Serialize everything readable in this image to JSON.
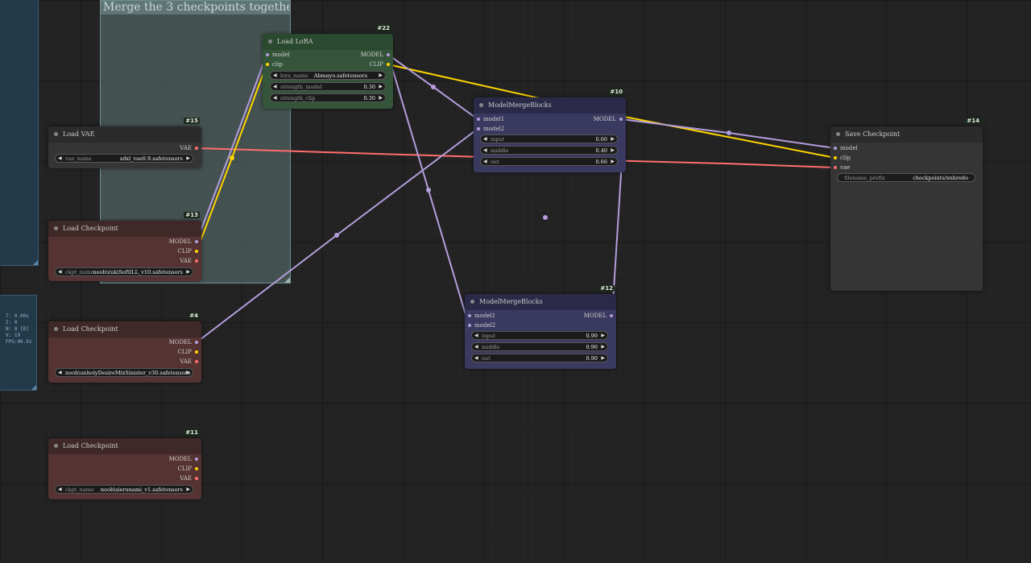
{
  "stats": {
    "lines": [
      "T: 0.00s",
      "I: 0",
      "N: 8 [8]",
      "V: 19",
      "FPS:90.91"
    ]
  },
  "group": {
    "title": "Merge the 3 checkpoints together"
  },
  "nodes": {
    "lora": {
      "id": "#22",
      "title": "Load LoRA",
      "in_model": "model",
      "in_clip": "clip",
      "out_model": "MODEL",
      "out_clip": "CLIP",
      "w1_label": "lora_name",
      "w1_value": "Abmayo.safetensors",
      "w2_label": "strength_model",
      "w2_value": "0.30",
      "w3_label": "strength_clip",
      "w3_value": "0.30"
    },
    "vae": {
      "id": "#15",
      "title": "Load VAE",
      "out_vae": "VAE",
      "w1_label": "vae_name",
      "w1_value": "sdxl_vae0.9.safetensors"
    },
    "ckpt13": {
      "id": "#13",
      "title": "Load Checkpoint",
      "out_model": "MODEL",
      "out_clip": "CLIP",
      "out_vae": "VAE",
      "w1_label": "ckpt_name",
      "w1_value": "noob\\zukiSoftILL_v10.safetensors"
    },
    "ckpt4": {
      "id": "#4",
      "title": "Load Checkpoint",
      "out_model": "MODEL",
      "out_clip": "CLIP",
      "out_vae": "VAE",
      "w1_value": "noob\\unholyDesireMixSinister_v30.safetensors"
    },
    "ckpt11": {
      "id": "#11",
      "title": "Load Checkpoint",
      "out_model": "MODEL",
      "out_clip": "CLIP",
      "out_vae": "VAE",
      "w1_label": "ckpt_name",
      "w1_value": "noob\\sierunami_v1.safetensors"
    },
    "merge10": {
      "id": "#10",
      "title": "ModelMergeBlocks",
      "in_model1": "model1",
      "in_model2": "model2",
      "out_model": "MODEL",
      "w1_label": "input",
      "w1_value": "0.60",
      "w2_label": "middle",
      "w2_value": "0.40",
      "w3_label": "out",
      "w3_value": "0.66"
    },
    "merge12": {
      "id": "#12",
      "title": "ModelMergeBlocks",
      "in_model1": "model1",
      "in_model2": "model2",
      "out_model": "MODEL",
      "w1_label": "input",
      "w1_value": "0.90",
      "w2_label": "middle",
      "w2_value": "0.90",
      "w3_label": "out",
      "w3_value": "0.90"
    },
    "save": {
      "id": "#14",
      "title": "Save Checkpoint",
      "in_model": "model",
      "in_clip": "clip",
      "in_vae": "vae",
      "w1_label": "filename_prefix",
      "w1_value": "checkpoints/xnhredo"
    }
  },
  "colors": {
    "model_link": "#b39ddb",
    "clip_link": "#ffd500",
    "vae_link": "#ff6e6e"
  }
}
